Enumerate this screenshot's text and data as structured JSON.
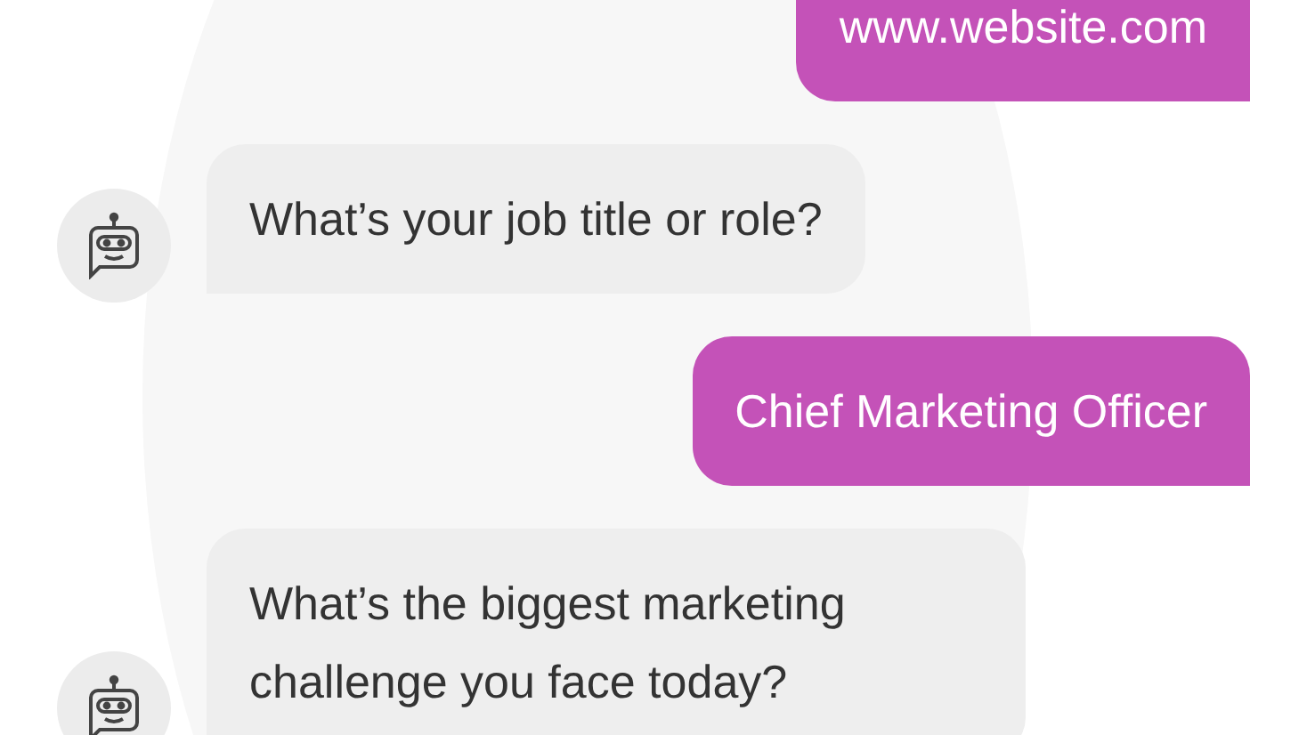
{
  "messages": [
    {
      "kind": "user",
      "text": "www.website.com"
    },
    {
      "kind": "bot",
      "text": "What’s your job title or role?"
    },
    {
      "kind": "user",
      "text": "Chief Marketing Officer"
    },
    {
      "kind": "bot",
      "text": "What’s the biggest marketing challenge you face today?"
    }
  ]
}
